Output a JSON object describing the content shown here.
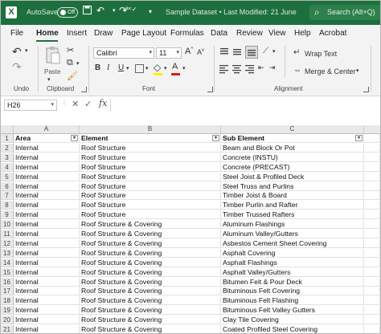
{
  "titlebar": {
    "app_logo": "X",
    "autosave_label": "AutoSave",
    "toggle_state": "Off",
    "document_title": "Sample Dataset • Last Modified: 21 June",
    "search_placeholder": "Search (Alt+Q)",
    "quick_access_icons": [
      "save-icon",
      "undo-icon",
      "redo-icon",
      "spelling-icon",
      "customize-icon"
    ]
  },
  "menu": {
    "tabs": [
      "File",
      "Home",
      "Insert",
      "Draw",
      "Page Layout",
      "Formulas",
      "Data",
      "Review",
      "View",
      "Help",
      "Acrobat"
    ],
    "active": "Home"
  },
  "ribbon": {
    "undo_group": "Undo",
    "clipboard_group": "Clipboard",
    "paste_label": "Paste",
    "font_group": "Font",
    "font_name": "Calibri",
    "font_size": "11",
    "bold": "B",
    "italic": "I",
    "underline": "U",
    "grow_font": "A",
    "shrink_font": "A",
    "font_color": "A",
    "alignment_group": "Alignment",
    "wrap_text": "Wrap Text",
    "merge_center": "Merge & Center",
    "accent_color": "#1e6f3e"
  },
  "formula_bar": {
    "name_box": "H26",
    "fx": "fx",
    "cancel": "✕",
    "enter": "✓",
    "value": ""
  },
  "sheet": {
    "columns": [
      "A",
      "B",
      "C"
    ],
    "row_numbers": [
      "1",
      "2",
      "3",
      "4",
      "5",
      "6",
      "7",
      "8",
      "9",
      "10",
      "11",
      "12",
      "13",
      "14",
      "15",
      "16",
      "17",
      "18",
      "19",
      "20",
      "21"
    ],
    "headers": [
      "Area",
      "Element",
      "Sub Element"
    ],
    "rows": [
      [
        "Internal",
        "Roof Structure",
        "Beam and Block Or Pot"
      ],
      [
        "Internal",
        "Roof Structure",
        "Concrete (INSTU)"
      ],
      [
        "Internal",
        "Roof Structure",
        "Concrete (PRECAST)"
      ],
      [
        "Internal",
        "Roof Structure",
        "Steel Joist & Profiled Deck"
      ],
      [
        "Internal",
        "Roof Structure",
        "Steel Truss and Purlins"
      ],
      [
        "Internal",
        "Roof Structure",
        "Timber Joist & Board"
      ],
      [
        "Internal",
        "Roof Structure",
        "Timber Purlin and Rafter"
      ],
      [
        "Internal",
        "Roof Structure",
        "Timber Trussed Rafters"
      ],
      [
        "Internal",
        "Roof Structure & Covering",
        "Aluminum Flashings"
      ],
      [
        "Internal",
        "Roof Structure & Covering",
        "Aluminum Valley/Gutters"
      ],
      [
        "Internal",
        "Roof Structure & Covering",
        "Asbestos Cement Sheet Covering"
      ],
      [
        "Internal",
        "Roof Structure & Covering",
        "Asphalt Covering"
      ],
      [
        "Internal",
        "Roof Structure & Covering",
        "Asphalt Flashings"
      ],
      [
        "Internal",
        "Roof Structure & Covering",
        "Asphalt Valley/Gutters"
      ],
      [
        "Internal",
        "Roof Structure & Covering",
        "Bitumen Felt & Pour Deck"
      ],
      [
        "Internal",
        "Roof Structure & Covering",
        "Bituminous Felt Covering"
      ],
      [
        "Internal",
        "Roof Structure & Covering",
        "Bituminous Felt Flashing"
      ],
      [
        "Internal",
        "Roof Structure & Covering",
        "Bituminous Felt Valley Gutters"
      ],
      [
        "Internal",
        "Roof Structure & Covering",
        "Clay Tile Covering"
      ],
      [
        "Internal",
        "Roof Structure & Covering",
        "Coated Profiled Steel Covering"
      ]
    ]
  }
}
